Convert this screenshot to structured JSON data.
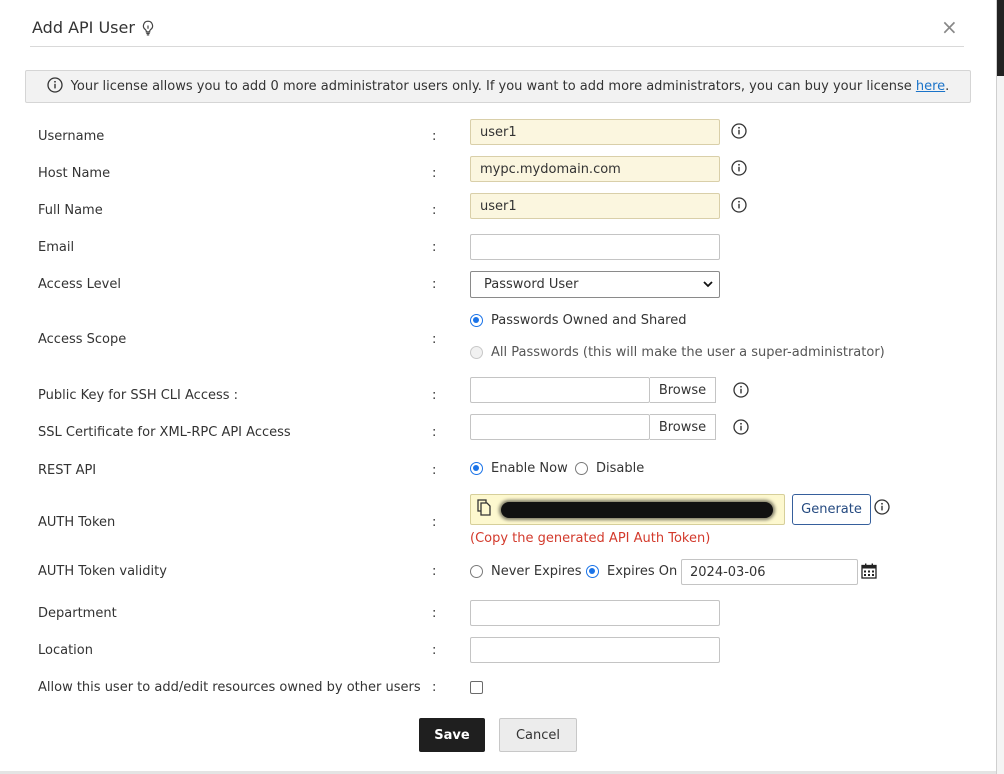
{
  "dialog": {
    "title": "Add API User",
    "close_label": "×"
  },
  "notice": {
    "text": "Your license allows you to add 0 more administrator users only. If you want to add more administrators, you can buy your license",
    "link": "here",
    "after": "."
  },
  "form": {
    "username": {
      "label": "Username",
      "value": "user1"
    },
    "hostname": {
      "label": "Host Name",
      "value": "mypc.mydomain.com"
    },
    "fullname": {
      "label": "Full Name",
      "value": "user1"
    },
    "email": {
      "label": "Email",
      "value": ""
    },
    "access_level": {
      "label": "Access Level",
      "selected": "Password User"
    },
    "access_scope": {
      "label": "Access Scope",
      "options": [
        "Passwords Owned and Shared",
        "All Passwords (this will make the user a super-administrator)"
      ],
      "selected_index": 0
    },
    "ssh_key": {
      "label": "Public Key for SSH CLI Access :",
      "browse": "Browse"
    },
    "ssl_cert": {
      "label": "SSL Certificate for XML-RPC API Access",
      "browse": "Browse"
    },
    "rest_api": {
      "label": "REST API",
      "options": [
        "Enable Now",
        "Disable"
      ],
      "selected_index": 0
    },
    "auth_token": {
      "label": "AUTH Token",
      "generate": "Generate",
      "note": "(Copy the generated API Auth Token)"
    },
    "token_validity": {
      "label": "AUTH Token validity",
      "options": [
        "Never Expires",
        "Expires On"
      ],
      "selected_index": 1,
      "date": "2024-03-06"
    },
    "department": {
      "label": "Department",
      "value": ""
    },
    "location": {
      "label": "Location",
      "value": ""
    },
    "allow_edit": {
      "label": "Allow this user to add/edit resources owned by other users",
      "checked": false
    },
    "colon": ":"
  },
  "actions": {
    "save": "Save",
    "cancel": "Cancel"
  },
  "colors": {
    "accent": "#1a73e8",
    "readonly_bg": "#fbf6df",
    "token_bg": "#fdf8cf",
    "error": "#d33a2c"
  }
}
